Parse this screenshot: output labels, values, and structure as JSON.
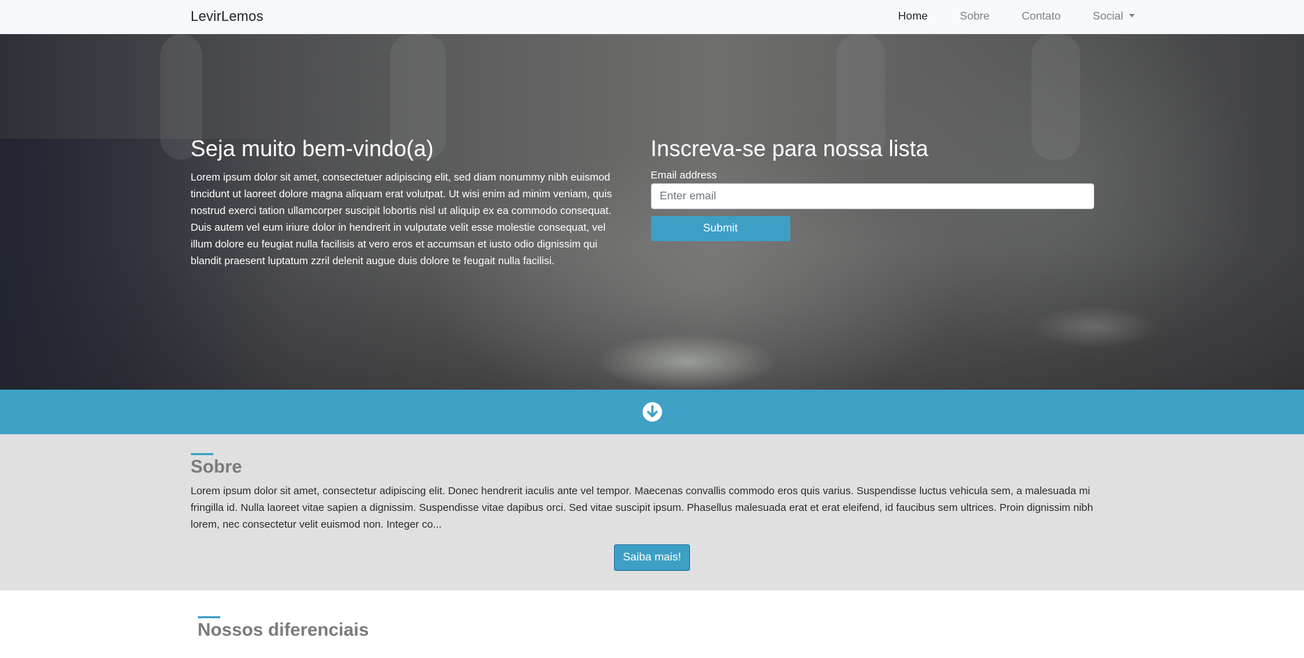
{
  "navbar": {
    "brand": "LevirLemos",
    "items": [
      {
        "label": "Home"
      },
      {
        "label": "Sobre"
      },
      {
        "label": "Contato"
      },
      {
        "label": "Social"
      }
    ]
  },
  "hero": {
    "welcome_title": "Seja muito bem-vindo(a)",
    "welcome_text": "Lorem ipsum dolor sit amet, consectetuer adipiscing elit, sed diam nonummy nibh euismod tincidunt ut laoreet dolore magna aliquam erat volutpat. Ut wisi enim ad minim veniam, quis nostrud exerci tation ullamcorper suscipit lobortis nisl ut aliquip ex ea commodo consequat. Duis autem vel eum iriure dolor in hendrerit in vulputate velit esse molestie consequat, vel illum dolore eu feugiat nulla facilisis at vero eros et accumsan et iusto odio dignissim qui blandit praesent luptatum zzril delenit augue duis dolore te feugait nulla facilisi.",
    "signup_title": "Inscreva-se para nossa lista",
    "email_label": "Email address",
    "email_placeholder": "Enter email",
    "email_value": "",
    "submit_label": "Submit"
  },
  "band": {
    "icon": "arrow-circle-down-icon"
  },
  "sobre": {
    "title": "Sobre",
    "text": "Lorem ipsum dolor sit amet, consectetur adipiscing elit. Donec hendrerit iaculis ante vel tempor. Maecenas convallis commodo eros quis varius. Suspendisse luctus vehicula sem, a malesuada mi fringilla id. Nulla laoreet vitae sapien a dignissim. Suspendisse vitae dapibus orci. Sed vitae suscipit ipsum. Phasellus malesuada erat et erat eleifend, id faucibus sem ultrices. Proin dignissim nibh lorem, nec consectetur velit euismod non. Integer co...",
    "button_label": "Saiba mais!"
  },
  "diferenciais": {
    "title": "Nossos diferenciais"
  },
  "colors": {
    "accent": "#3fa1c6",
    "navbar_bg": "#f8f9fa",
    "sobre_bg": "#e0e0e0"
  }
}
